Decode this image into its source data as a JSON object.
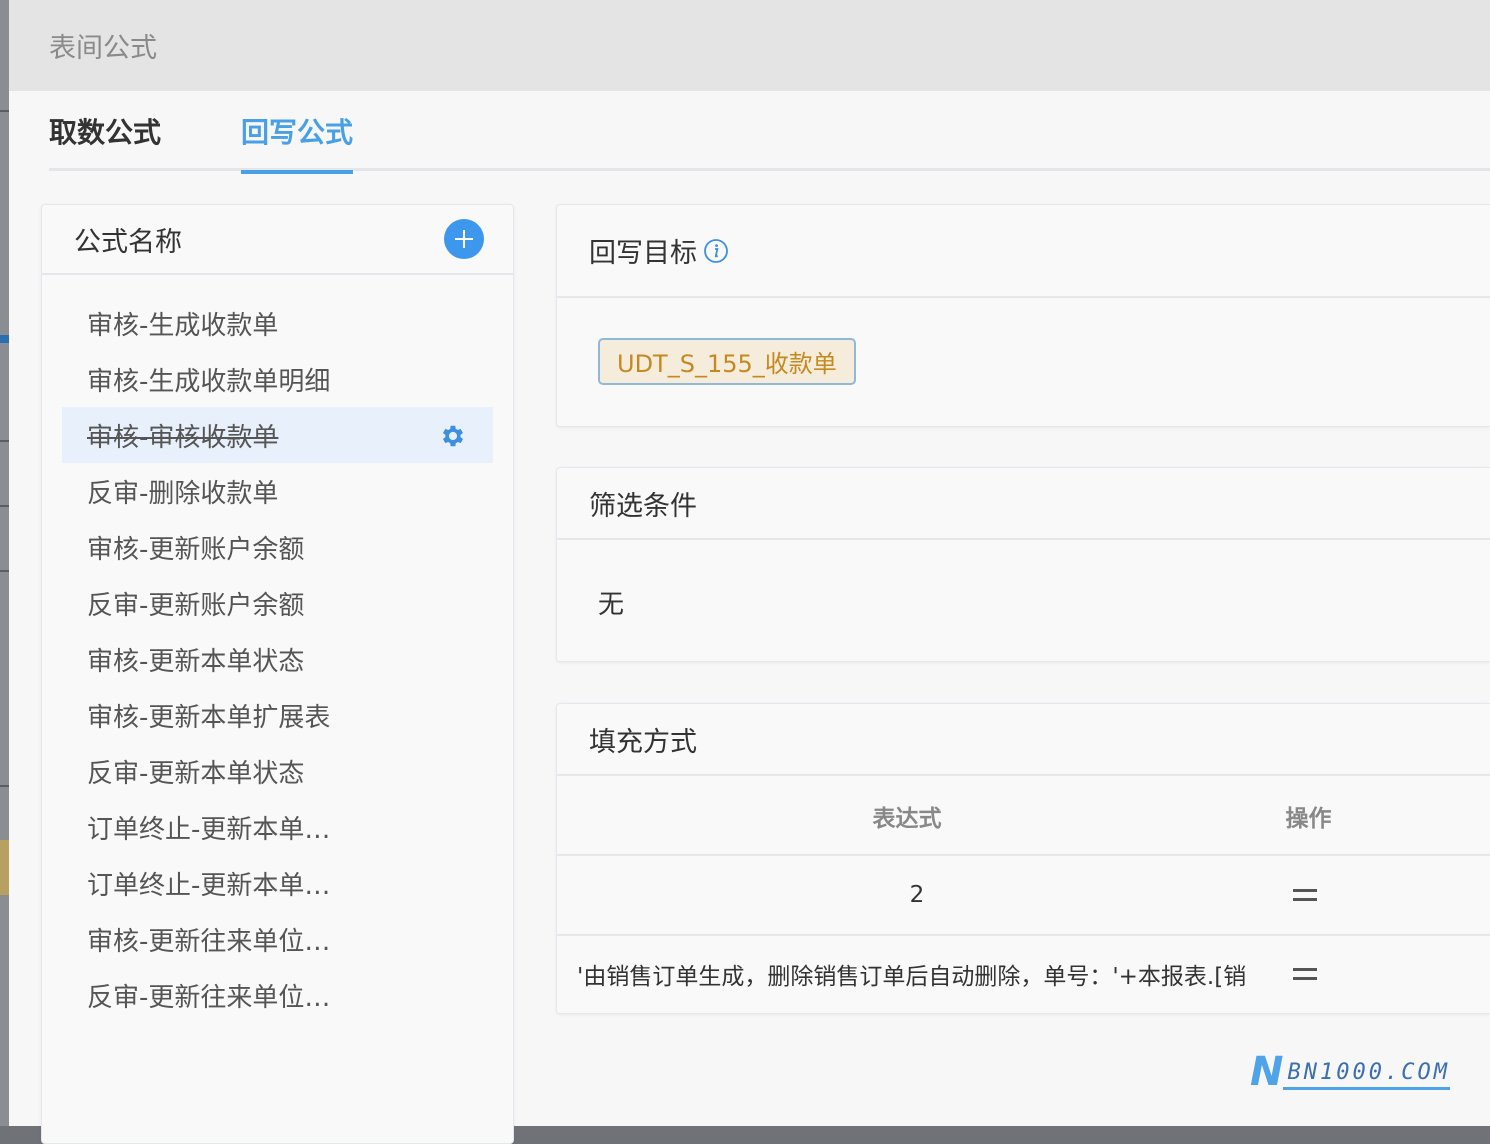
{
  "dialog": {
    "title": "表间公式"
  },
  "tabs": [
    {
      "label": "取数公式",
      "active": false
    },
    {
      "label": "回写公式",
      "active": true
    }
  ],
  "formula_panel": {
    "title": "公式名称",
    "add_icon": "plus-icon",
    "items": [
      {
        "label": "审核-生成收款单"
      },
      {
        "label": "审核-生成收款单明细"
      },
      {
        "label": "审核-审核收款单",
        "selected": true,
        "disabled": true
      },
      {
        "label": "反审-删除收款单"
      },
      {
        "label": "审核-更新账户余额"
      },
      {
        "label": "反审-更新账户余额"
      },
      {
        "label": "审核-更新本单状态"
      },
      {
        "label": "审核-更新本单扩展表"
      },
      {
        "label": "反审-更新本单状态"
      },
      {
        "label": "订单终止-更新本单…"
      },
      {
        "label": "订单终止-更新本单…"
      },
      {
        "label": "审核-更新往来单位…"
      },
      {
        "label": "反审-更新往来单位…"
      }
    ]
  },
  "writeback_target": {
    "title": "回写目标",
    "info_icon": "info-icon",
    "tag": "UDT_S_155_收款单"
  },
  "filter": {
    "title": "筛选条件",
    "value": "无"
  },
  "fill": {
    "title": "填充方式",
    "columns": {
      "expression": "表达式",
      "operation": "操作"
    },
    "rows": [
      {
        "expression": "2"
      },
      {
        "expression": "'由销售订单生成，删除销售订单后自动删除，单号：'+本报表.[销"
      }
    ]
  },
  "watermark": {
    "mark": "N",
    "text": "BN1000.COM"
  },
  "colors": {
    "accent": "#4aa0e6",
    "tag_text": "#c58a1f",
    "tag_bg": "#f5ecdc"
  }
}
